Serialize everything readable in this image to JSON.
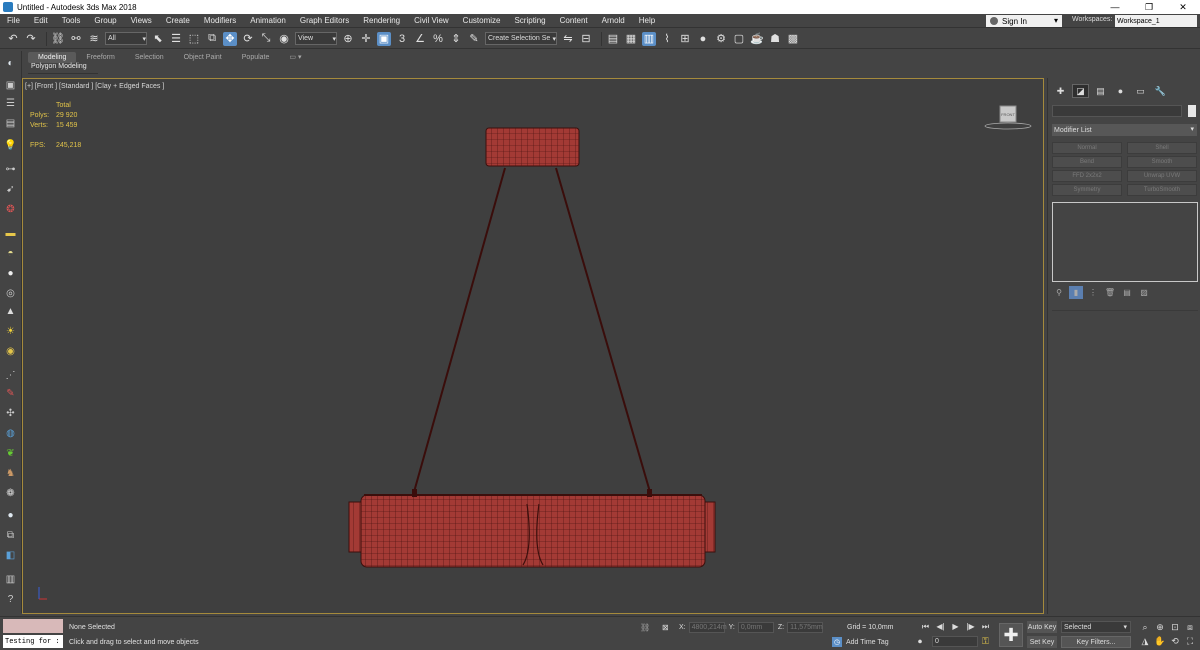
{
  "window": {
    "title": "Untitled - Autodesk 3ds Max 2018",
    "controls": [
      "—",
      "❐",
      "✕"
    ]
  },
  "menu": {
    "items": [
      "File",
      "Edit",
      "Tools",
      "Group",
      "Views",
      "Create",
      "Modifiers",
      "Animation",
      "Graph Editors",
      "Rendering",
      "Civil View",
      "Customize",
      "Scripting",
      "Content",
      "Arnold",
      "Help"
    ],
    "signin": "Sign In",
    "workspaces_label": "Workspaces:",
    "workspace_value": "Workspace_1"
  },
  "toolbar": {
    "selection_filter": "All",
    "ref_coord": "View",
    "selection_set": "Create Selection Se"
  },
  "ribbon": {
    "tabs": [
      "Modeling",
      "Freeform",
      "Selection",
      "Object Paint",
      "Populate"
    ],
    "panel_label": "Polygon Modeling"
  },
  "viewport": {
    "label": "[+] [Front ] [Standard ] [Clay + Edged Faces ]",
    "stats": {
      "header": "Total",
      "polys_label": "Polys:",
      "polys_value": "29 920",
      "verts_label": "Verts:",
      "verts_value": "15 459",
      "fps_label": "FPS:",
      "fps_value": "245,218"
    },
    "viewcube_label": "FRONT"
  },
  "command_panel": {
    "modifier_list": "Modifier List",
    "buttons": [
      "Normal",
      "Shell",
      "Bend",
      "Smooth",
      "FFD 2x2x2",
      "Unwrap UVW",
      "Symmetry",
      "TurboSmooth"
    ]
  },
  "status": {
    "selection": "None Selected",
    "prompt": "Click and drag to select and move objects",
    "script_text": "Testing for :",
    "x_label": "X:",
    "x_value": "4800,214m",
    "y_label": "Y:",
    "y_value": "0,0mm",
    "z_label": "Z:",
    "z_value": "11,575mm",
    "grid": "Grid = 10,0mm",
    "add_time_tag": "Add Time Tag",
    "frame": "0",
    "auto_key": "Auto Key",
    "set_key": "Set Key",
    "key_mode": "Selected",
    "key_filters": "Key Filters..."
  },
  "colors": {
    "background": "#444444",
    "viewport": "#3f3f3f",
    "viewport_border": "#a58a3c",
    "stats_text": "#e2c44a",
    "model_fill": "#a33a35",
    "model_wire": "#4a1210",
    "active_blue": "#5b8fc7"
  }
}
